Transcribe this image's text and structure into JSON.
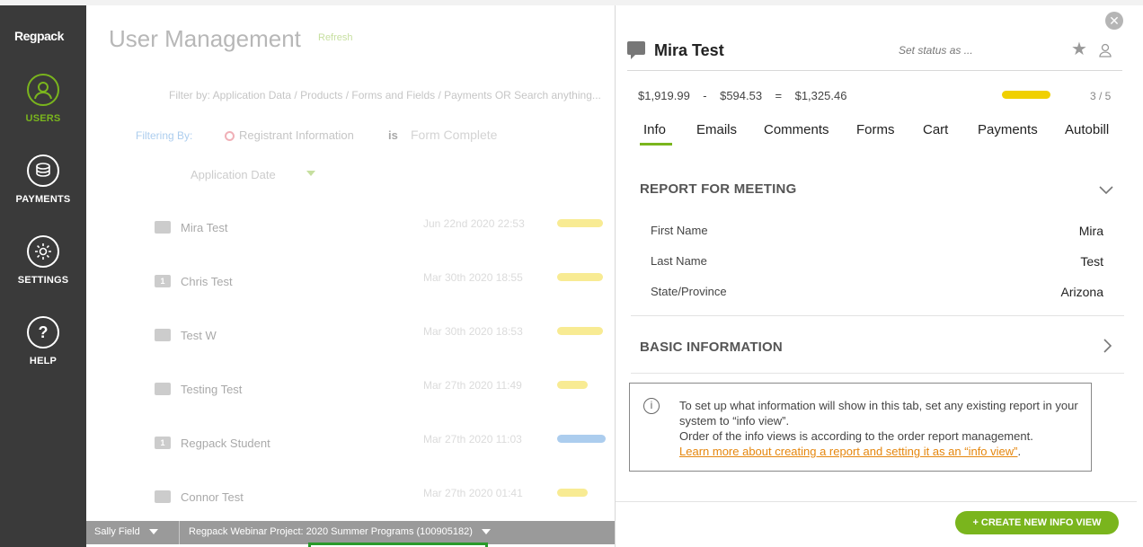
{
  "sidebar": {
    "logo": "Regpack",
    "items": [
      {
        "label": "USERS",
        "icon": "user-icon",
        "active": true
      },
      {
        "label": "PAYMENTS",
        "icon": "coins-icon",
        "active": false
      },
      {
        "label": "SETTINGS",
        "icon": "gear-icon",
        "active": false
      },
      {
        "label": "HELP",
        "icon": "question-icon",
        "active": false
      }
    ]
  },
  "main": {
    "title": "User Management",
    "refresh": "Refresh",
    "filter_hint": "Filter by: Application Data / Products / Forms and Fields / Payments OR Search anything...",
    "filtering_by": "Filtering By:",
    "filter_field": "Registrant Information",
    "filter_is": "is",
    "filter_value": "Form Complete",
    "sort_label": "Application Date",
    "rows": [
      {
        "name": "Mira Test",
        "date": "Jun 22nd 2020 22:53",
        "icon": "chat",
        "bar": 0.95,
        "bar_color": "#f0d000"
      },
      {
        "name": "Chris Test",
        "date": "Mar 30th 2020 18:55",
        "icon": "1",
        "bar": 0.95,
        "bar_color": "#f0d000"
      },
      {
        "name": "Test W",
        "date": "Mar 30th 2020 18:53",
        "icon": "chat",
        "bar": 0.95,
        "bar_color": "#f0d000"
      },
      {
        "name": "Testing Test",
        "date": "Mar 27th 2020 11:49",
        "icon": "chat",
        "bar": 0.63,
        "bar_color": "#f0d000"
      },
      {
        "name": "Regpack Student",
        "date": "Mar 27th 2020 11:03",
        "icon": "1",
        "bar": 1.0,
        "bar_color": "#3b8ad9"
      },
      {
        "name": "Connor Test",
        "date": "Mar 27th 2020 01:41",
        "icon": "chat",
        "bar": 0.63,
        "bar_color": "#f0d000"
      }
    ]
  },
  "bottombar": {
    "user": "Sally Field",
    "project": "Regpack Webinar Project: 2020 Summer Programs (100905182)"
  },
  "panel": {
    "name": "Mira Test",
    "status_placeholder": "Set status as ...",
    "balance": {
      "total": "$1,919.99",
      "minus": "-",
      "paid": "$594.53",
      "equals": "=",
      "due": "$1,325.46"
    },
    "progress_text": "3 / 5",
    "progress_value": 0.6,
    "tabs": [
      "Info",
      "Emails",
      "Comments",
      "Forms",
      "Cart",
      "Payments",
      "Autobill"
    ],
    "active_tab": "Info",
    "sections": [
      {
        "title": "REPORT FOR MEETING",
        "expanded": true,
        "fields": [
          {
            "label": "First Name",
            "value": "Mira"
          },
          {
            "label": "Last Name",
            "value": "Test"
          },
          {
            "label": "State/Province",
            "value": "Arizona"
          }
        ]
      },
      {
        "title": "BASIC INFORMATION",
        "expanded": false
      }
    ],
    "info": {
      "line1": "To set up what information will show in this tab, set any existing report in your system to “info view”.",
      "line2": "Order of the info views is according to the order report management.",
      "link": "Learn more about creating a report and setting it as an “info view”",
      "after_link": "."
    },
    "create_button": "CREATE NEW INFO VIEW",
    "create_button_icon": "plus-icon",
    "accent": "#7ab51d"
  }
}
